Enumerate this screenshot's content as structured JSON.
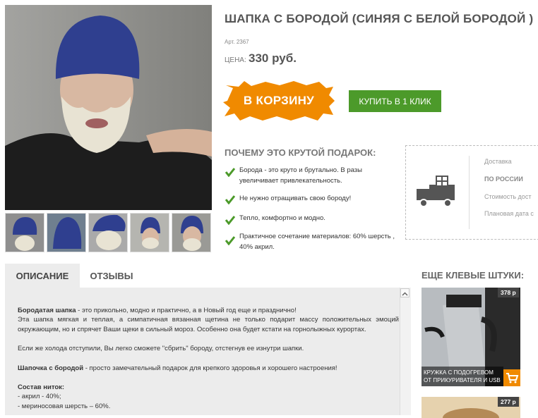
{
  "product": {
    "title": "ШАПКА С БОРОДОЙ (СИНЯЯ С БЕЛОЙ БОРОДОЙ )",
    "sku": "Арт. 2367",
    "price_label": "ЦЕНА:",
    "price": "330 руб.",
    "cart_label": "В КОРЗИНУ",
    "buy_one_click": "КУПИТЬ В 1 КЛИК"
  },
  "why": {
    "title": "ПОЧЕМУ ЭТО КРУТОЙ ПОДАРОК:",
    "reasons": [
      "Борода - это круто и брутально. В разы увеличивает привлекательность.",
      "Не нужно отращивать свою бороду!",
      "Тепло, комфортно и модно.",
      "Практичное сочетание материалов: 60% шерсть , 40% акрил."
    ]
  },
  "delivery": {
    "lines": [
      "Доставка",
      "ПО РОССИИ",
      "Стоимость дост",
      "Плановая дата с"
    ]
  },
  "tabs": [
    "ОПИСАНИЕ",
    "ОТЗЫВЫ"
  ],
  "description": {
    "p1_bold": "Бородатая шапка",
    "p1_rest": " - это прикольно, модно и практично, а в Новый год еще и празднично!",
    "p2": "Эта шапка мягкая и теплая, а симпатичная вязанная щетина не только подарит массу положительных эмоций окружающим, но и спрячет Ваши щеки в сильный мороз. Особенно она будет кстати на горнолыжных курортах.",
    "p3": "Если же холода отступили, Вы легко сможете \"сбрить\" бороду, отстегнув ее изнутри шапки.",
    "p4_bold": "Шапочка с бородой",
    "p4_rest": " - просто замечательный подарок для крепкого здоровья и хорошего настроения!",
    "p5_bold": "Состав ниток:",
    "p6": "- акрил - 40%;",
    "p7": "- мериносовая шерсть – 60%."
  },
  "more": {
    "title": "ЕЩЕ КЛЕВЫЕ ШТУКИ:",
    "items": [
      {
        "price": "378 р",
        "caption": "КРУЖКА С ПОДОГРЕВОМ ОТ ПРИКУРИВАТЕЛЯ И USB"
      },
      {
        "price": "277 р"
      }
    ]
  },
  "colors": {
    "accent_orange": "#f08a00",
    "buy_green": "#4c9a2a",
    "hat_blue": "#2f3f8f"
  }
}
